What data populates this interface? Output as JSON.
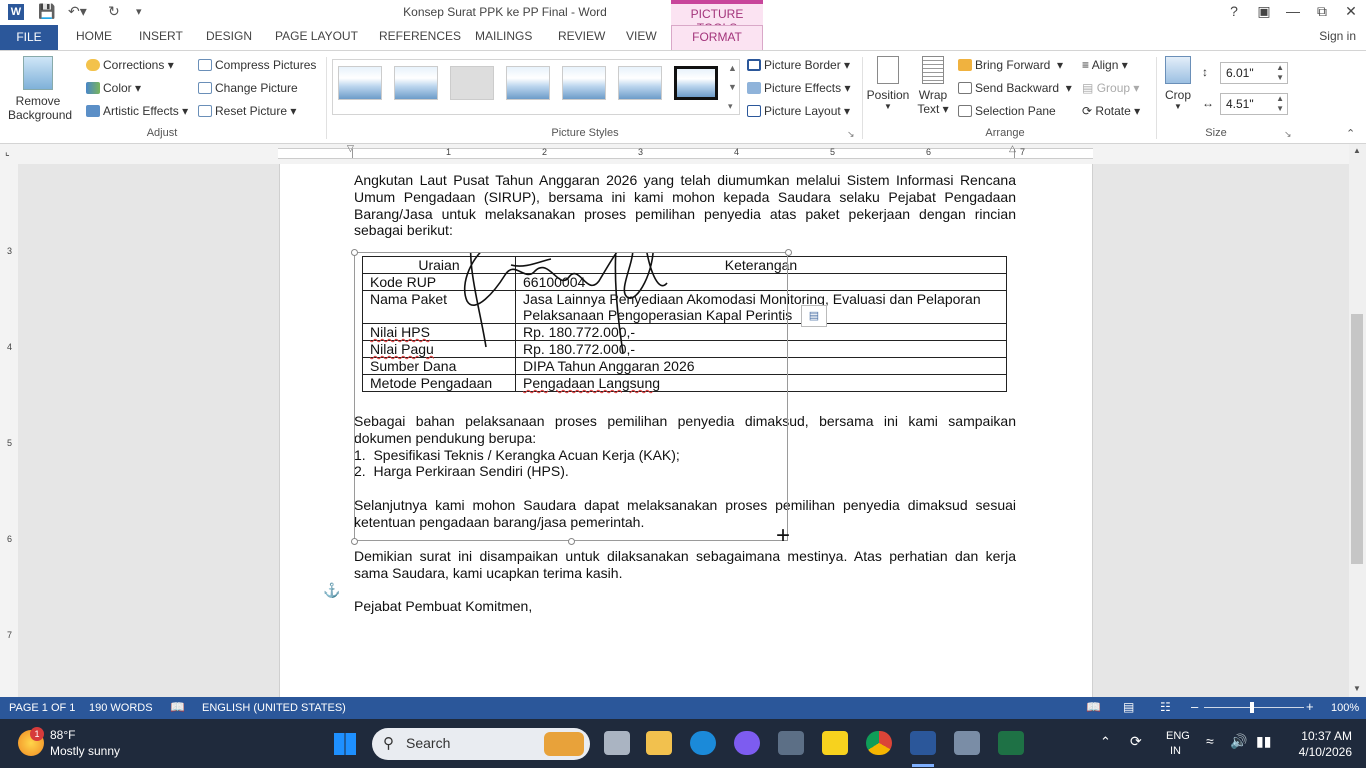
{
  "window": {
    "title": "Konsep Surat PPK ke PP Final - Word",
    "contextual_tab_group": "PICTURE TOOLS"
  },
  "tabs": [
    "FILE",
    "HOME",
    "INSERT",
    "DESIGN",
    "PAGE LAYOUT",
    "REFERENCES",
    "MAILINGS",
    "REVIEW",
    "VIEW",
    "FORMAT"
  ],
  "sign_in": "Sign in",
  "ribbon": {
    "adjust": {
      "remove_background_line1": "Remove",
      "remove_background_line2": "Background",
      "corrections": "Corrections",
      "color": "Color",
      "artistic_effects": "Artistic Effects",
      "compress_pictures": "Compress Pictures",
      "change_picture": "Change Picture",
      "reset_picture": "Reset Picture",
      "label": "Adjust"
    },
    "picture_styles": {
      "picture_border": "Picture Border",
      "picture_effects": "Picture Effects",
      "picture_layout": "Picture Layout",
      "label": "Picture Styles"
    },
    "arrange": {
      "position": "Position",
      "wrap_text_line1": "Wrap",
      "wrap_text_line2": "Text",
      "bring_forward": "Bring Forward",
      "send_backward": "Send Backward",
      "selection_pane": "Selection Pane",
      "align": "Align",
      "group": "Group",
      "rotate": "Rotate",
      "label": "Arrange"
    },
    "size": {
      "crop": "Crop",
      "height": "6.01\"",
      "width": "4.51\"",
      "label": "Size"
    }
  },
  "ruler": {
    "h_numbers": [
      "1",
      "2",
      "3",
      "4",
      "5",
      "6",
      "7"
    ],
    "v_numbers": [
      "3",
      "4",
      "5",
      "6",
      "7"
    ]
  },
  "document": {
    "para1": [
      "Angkutan Laut Pusat Tahun Anggaran 2026 yang telah diumumkan melalui Sistem Informasi Rencana",
      "Umum Pengadaan (SIRUP), bersama ini kami mohon kepada Saudara selaku Pejabat Pengadaan",
      "Barang/Jasa untuk melaksanakan proses pemilihan penyedia atas paket pekerjaan dengan rincian",
      "sebagai berikut:"
    ],
    "table": {
      "headers": [
        "Uraian",
        "Keterangan"
      ],
      "rows": [
        [
          "Kode RUP",
          "66100004"
        ],
        [
          "Nama Paket",
          "Jasa Lainnya Penyediaan Akomodasi Monitoring, Evaluasi dan Pelaporan Pelaksanaan Pengoperasian Kapal Perintis"
        ],
        [
          "Nilai HPS",
          "Rp. 180.772.000,-"
        ],
        [
          "Nilai Pagu",
          "Rp. 180.772.000,-"
        ],
        [
          "Sumber Dana",
          "DIPA Tahun Anggaran 2026"
        ],
        [
          "Metode Pengadaan",
          "Pengadaan Langsung"
        ]
      ]
    },
    "para2": [
      "Sebagai bahan pelaksanaan proses pemilihan penyedia dimaksud, bersama ini kami sampaikan",
      "dokumen pendukung berupa:"
    ],
    "list": [
      "1.  Spesifikasi Teknis / Kerangka Acuan Kerja (KAK);",
      "2.  Harga Perkiraan Sendiri (HPS)."
    ],
    "para3": [
      "Selanjutnya kami mohon Saudara dapat melaksanakan proses pemilihan penyedia dimaksud sesuai",
      "ketentuan pengadaan barang/jasa pemerintah."
    ],
    "para4": [
      "Demikian surat ini disampaikan untuk dilaksanakan sebagaimana mestinya. Atas perhatian dan kerja",
      "sama Saudara, kami ucapkan terima kasih."
    ],
    "closing": "Pejabat Pembuat Komitmen,"
  },
  "status": {
    "page": "PAGE 1 OF 1",
    "words": "190 WORDS",
    "language": "ENGLISH (UNITED STATES)",
    "zoom": "100%"
  },
  "taskbar": {
    "weather_temp": "88°F",
    "weather_desc": "Mostly sunny",
    "weather_badge": "1",
    "search_placeholder": "Search",
    "lang_line1": "ENG",
    "lang_line2": "IN",
    "time": "10:37 AM",
    "date": "4/10/2026"
  },
  "colors": {
    "word_blue": "#2b579a",
    "picture_tools_pink": "#c8459b"
  }
}
